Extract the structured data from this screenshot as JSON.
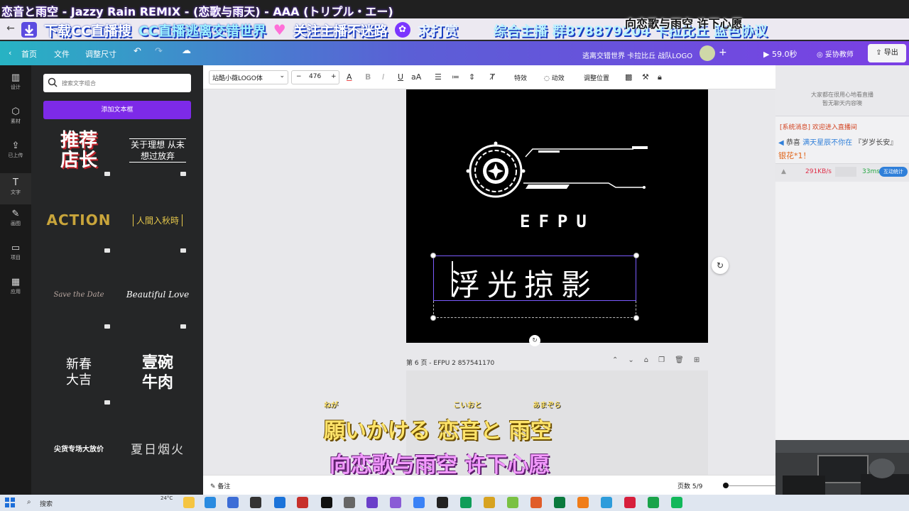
{
  "stream": {
    "title": "恋音と雨空 - Jazzy Rain REMIX - (恋歌与雨天) - AAA (トリプル・エー)",
    "banner": [
      "下载CC直播搜",
      "CC直播逃离交错世界",
      "关注主播不迷路",
      "求打赏",
      "综合主播 群878879204 卡拉比丘 蓝色协议"
    ],
    "banner_icons": {
      "download": "download-icon",
      "heart": "heart-icon",
      "gift": "gift-icon"
    }
  },
  "overlay_lyric_top": "向恋歌与雨空 许下心愿",
  "header": {
    "home": "首页",
    "file": "文件",
    "resize": "调整尺寸",
    "doc_name": "逃离交错世界 卡拉比丘 战队LOGO",
    "play": "59.0秒",
    "teacher": "妥协教师",
    "export": "导出"
  },
  "rail": [
    {
      "icon": "layout-icon",
      "label": "设计"
    },
    {
      "icon": "elements-icon",
      "label": "素材"
    },
    {
      "icon": "upload-icon",
      "label": "已上传"
    },
    {
      "icon": "text-icon",
      "label": "文字"
    },
    {
      "icon": "draw-icon",
      "label": "画图"
    },
    {
      "icon": "folder-icon",
      "label": "项目"
    },
    {
      "icon": "apps-icon",
      "label": "应用"
    }
  ],
  "panel": {
    "search_placeholder": "搜索文字组合",
    "add_text": "添加文本框",
    "tiles": [
      "推荐 店长",
      "关于理想 从未想过放弃",
      "ACTION",
      "人間入秋時",
      "Save the Date",
      "Beautiful Love",
      "新春大吉",
      "壹碗 牛肉",
      "尖货专场大放价",
      "夏日烟火"
    ]
  },
  "toolbar": {
    "font": "站酷小薇LOGO体",
    "size": "476",
    "effects": "特效",
    "animate": "动效",
    "position": "调整位置"
  },
  "canvas": {
    "logo_text": "EFPU",
    "caption": "浮光掠影"
  },
  "page": {
    "label": "第 6 页 - EFPU 2 857541170",
    "lyric_ruby": [
      "ねが",
      "こいおと",
      "あまぞら"
    ],
    "lyric_jp": "願いかける 恋音と 雨空",
    "lyric_cn": "向恋歌与雨空 许下心愿"
  },
  "footer": {
    "notes": "备注",
    "pages": "页数 5/9"
  },
  "side": {
    "notice": "大家都在很用心地看直播\n暂无聊天内容噢",
    "msg1": "[系统消息] 欢迎进入直播间",
    "msg2_prefix": "恭喜",
    "msg2_user": "满天星辰不你在",
    "msg2_suffix": "『岁岁长安』",
    "msg3": "银花*1！",
    "speed1": "291KB/s",
    "speed2": "33ms",
    "interact": "互动统计"
  },
  "taskbar": {
    "search": "搜索",
    "weather": "24°C"
  }
}
